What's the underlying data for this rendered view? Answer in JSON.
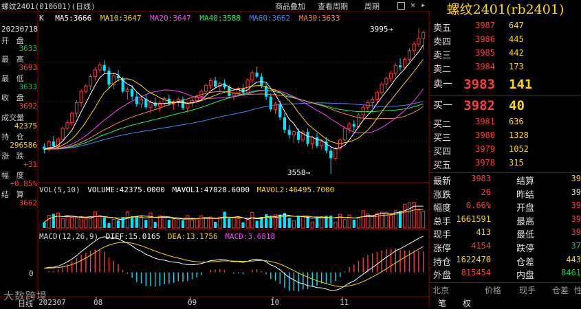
{
  "header": {
    "title": "螺纹2401(010601)(日线)",
    "buttons": [
      "商品叠加",
      "查看周期",
      "周期"
    ],
    "icons": [
      "square-icon",
      "close-icon"
    ]
  },
  "kline_header": {
    "label": "K",
    "ma5": "MA5:3666",
    "ma10": "MA10:3647",
    "ma20": "MA20:3647",
    "ma40": "MA40:3588",
    "ma60": "MA60:3662",
    "ma30": "MA30:3633"
  },
  "left_info": {
    "date": "20230718",
    "open_label": "开 盘",
    "open": "3633",
    "high_label": "最 高",
    "high": "3693",
    "low_label": "最 低",
    "low": "3633",
    "close_label": "收 盘",
    "close": "3692",
    "vol_label": "成交量",
    "vol": "42375",
    "oi_label": "持 仓",
    "oi": "296586",
    "chg_label": "涨 跌",
    "chg": "+31",
    "pct_label": "幅 度",
    "pct": "+0.85%",
    "settle_label": "结 算",
    "settle": "3662"
  },
  "annotations": {
    "high_mark": "3995",
    "low_mark": "3558"
  },
  "volume_header": {
    "label": "VOL(5,10)",
    "volume": "VOLUME:42375.0000",
    "mavol1": "MAVOL1:47828.6000",
    "mavol2": "MAVOL2:46495.7000"
  },
  "macd_header": {
    "label": "MACD(12,26,9)",
    "diff": "DIFF:15.0165",
    "dea": "DEA:13.1756",
    "macd": "MACD:3.6818",
    "zero": "0"
  },
  "x_axis": {
    "first_label": "日线",
    "first_date": "202307",
    "months": [
      "08",
      "09",
      "10",
      "11"
    ]
  },
  "watermark": "大数跨境",
  "right_panel": {
    "title": "螺纹2401(rb2401)",
    "asks": [
      {
        "label": "卖五",
        "price": "3987",
        "vol": "647"
      },
      {
        "label": "卖四",
        "price": "3986",
        "vol": "445"
      },
      {
        "label": "卖三",
        "price": "3985",
        "vol": "442"
      },
      {
        "label": "卖二",
        "price": "3984",
        "vol": "173"
      },
      {
        "label": "卖一",
        "price": "3983",
        "vol": "141"
      }
    ],
    "bids": [
      {
        "label": "买一",
        "price": "3982",
        "vol": "40"
      },
      {
        "label": "买二",
        "price": "3981",
        "vol": "636"
      },
      {
        "label": "买三",
        "price": "3980",
        "vol": "1328"
      },
      {
        "label": "买四",
        "price": "3979",
        "vol": "1052"
      },
      {
        "label": "买五",
        "price": "3978",
        "vol": "315"
      }
    ],
    "stats": [
      {
        "l1": "最新",
        "v1": "3983",
        "c1": "red",
        "l2": "结算",
        "v2": "39",
        "c2": "yel"
      },
      {
        "l1": "涨跌",
        "v1": "26",
        "c1": "red",
        "l2": "昨结",
        "v2": "39",
        "c2": "wht"
      },
      {
        "l1": "幅度",
        "v1": "0.66%",
        "c1": "red",
        "l2": "开盘",
        "v2": "39",
        "c2": "red"
      },
      {
        "l1": "总手",
        "v1": "1661591",
        "c1": "yel",
        "l2": "最高",
        "v2": "39",
        "c2": "red"
      },
      {
        "l1": "现手",
        "v1": "413",
        "c1": "yel",
        "l2": "最低",
        "v2": "39",
        "c2": "red"
      },
      {
        "l1": "涨停",
        "v1": "4154",
        "c1": "red",
        "l2": "跌停",
        "v2": "37",
        "c2": "grn"
      },
      {
        "l1": "持仓",
        "v1": "1622470",
        "c1": "yel",
        "l2": "仓差",
        "v2": "443",
        "c2": "yel"
      },
      {
        "l1": "外盘",
        "v1": "815454",
        "c1": "red",
        "l2": "内盘",
        "v2": "8461",
        "c2": "grn"
      }
    ],
    "table_header": [
      "北京",
      "价格",
      "现手",
      "仓差",
      "性"
    ],
    "tabs": [
      "笔",
      "权"
    ]
  },
  "colors": {
    "up": "#ff3b3b",
    "down": "#00e5ff",
    "ma5": "#ffffff",
    "ma10": "#ffd700",
    "ma20": "#ff44ff",
    "ma40": "#00ff66",
    "ma60": "#4488ff",
    "ma30": "#ff8844",
    "grid": "#a00000"
  },
  "chart_data": {
    "type": "candlestick",
    "price_range": [
      3540,
      4010
    ],
    "candles": [
      [
        3640,
        3650,
        3620,
        3632
      ],
      [
        3632,
        3660,
        3625,
        3655
      ],
      [
        3655,
        3672,
        3648,
        3640
      ],
      [
        3640,
        3668,
        3630,
        3662
      ],
      [
        3662,
        3700,
        3655,
        3695
      ],
      [
        3695,
        3720,
        3690,
        3712
      ],
      [
        3712,
        3745,
        3700,
        3740
      ],
      [
        3740,
        3780,
        3728,
        3772
      ],
      [
        3772,
        3812,
        3760,
        3806
      ],
      [
        3806,
        3828,
        3800,
        3822
      ],
      [
        3822,
        3858,
        3810,
        3850
      ],
      [
        3850,
        3878,
        3838,
        3870
      ],
      [
        3870,
        3892,
        3860,
        3885
      ],
      [
        3885,
        3900,
        3860,
        3868
      ],
      [
        3868,
        3880,
        3815,
        3826
      ],
      [
        3826,
        3860,
        3812,
        3852
      ],
      [
        3852,
        3870,
        3835,
        3845
      ],
      [
        3845,
        3850,
        3800,
        3805
      ],
      [
        3805,
        3820,
        3780,
        3812
      ],
      [
        3812,
        3825,
        3780,
        3790
      ],
      [
        3790,
        3805,
        3760,
        3768
      ],
      [
        3768,
        3790,
        3755,
        3782
      ],
      [
        3782,
        3795,
        3752,
        3758
      ],
      [
        3758,
        3780,
        3740,
        3772
      ],
      [
        3772,
        3786,
        3755,
        3762
      ],
      [
        3762,
        3778,
        3745,
        3770
      ],
      [
        3770,
        3790,
        3760,
        3784
      ],
      [
        3784,
        3796,
        3762,
        3768
      ],
      [
        3768,
        3780,
        3752,
        3775
      ],
      [
        3775,
        3788,
        3760,
        3782
      ],
      [
        3782,
        3790,
        3750,
        3756
      ],
      [
        3756,
        3775,
        3742,
        3770
      ],
      [
        3770,
        3785,
        3760,
        3778
      ],
      [
        3778,
        3795,
        3770,
        3790
      ],
      [
        3790,
        3812,
        3782,
        3806
      ],
      [
        3806,
        3830,
        3798,
        3824
      ],
      [
        3824,
        3845,
        3812,
        3838
      ],
      [
        3838,
        3850,
        3815,
        3820
      ],
      [
        3820,
        3835,
        3805,
        3830
      ],
      [
        3830,
        3842,
        3812,
        3818
      ],
      [
        3818,
        3825,
        3785,
        3792
      ],
      [
        3792,
        3805,
        3778,
        3800
      ],
      [
        3800,
        3820,
        3790,
        3815
      ],
      [
        3815,
        3828,
        3795,
        3802
      ],
      [
        3802,
        3845,
        3800,
        3840
      ],
      [
        3840,
        3870,
        3830,
        3862
      ],
      [
        3862,
        3880,
        3845,
        3850
      ],
      [
        3850,
        3860,
        3815,
        3822
      ],
      [
        3822,
        3830,
        3780,
        3790
      ],
      [
        3790,
        3800,
        3745,
        3752
      ],
      [
        3752,
        3775,
        3738,
        3768
      ],
      [
        3768,
        3778,
        3720,
        3728
      ],
      [
        3728,
        3740,
        3680,
        3690
      ],
      [
        3690,
        3705,
        3665,
        3675
      ],
      [
        3675,
        3690,
        3650,
        3685
      ],
      [
        3685,
        3695,
        3650,
        3660
      ],
      [
        3660,
        3690,
        3655,
        3684
      ],
      [
        3684,
        3695,
        3640,
        3648
      ],
      [
        3648,
        3672,
        3632,
        3668
      ],
      [
        3668,
        3680,
        3635,
        3642
      ],
      [
        3642,
        3660,
        3630,
        3655
      ],
      [
        3655,
        3668,
        3620,
        3628
      ],
      [
        3628,
        3640,
        3558,
        3605
      ],
      [
        3605,
        3640,
        3598,
        3635
      ],
      [
        3635,
        3665,
        3628,
        3660
      ],
      [
        3660,
        3700,
        3655,
        3695
      ],
      [
        3695,
        3715,
        3680,
        3708
      ],
      [
        3708,
        3720,
        3688,
        3700
      ],
      [
        3700,
        3740,
        3695,
        3735
      ],
      [
        3735,
        3765,
        3725,
        3758
      ],
      [
        3758,
        3780,
        3740,
        3772
      ],
      [
        3772,
        3790,
        3755,
        3782
      ],
      [
        3782,
        3808,
        3770,
        3802
      ],
      [
        3802,
        3835,
        3795,
        3828
      ],
      [
        3828,
        3850,
        3812,
        3845
      ],
      [
        3845,
        3868,
        3835,
        3860
      ],
      [
        3860,
        3890,
        3850,
        3884
      ],
      [
        3884,
        3905,
        3868,
        3878
      ],
      [
        3878,
        3908,
        3870,
        3902
      ],
      [
        3902,
        3935,
        3895,
        3928
      ],
      [
        3928,
        3955,
        3915,
        3948
      ],
      [
        3948,
        3995,
        3940,
        3965
      ],
      [
        3965,
        3988,
        3930,
        3983
      ]
    ],
    "volume_range": [
      0,
      60000
    ],
    "macd_range": [
      -45,
      60
    ]
  }
}
